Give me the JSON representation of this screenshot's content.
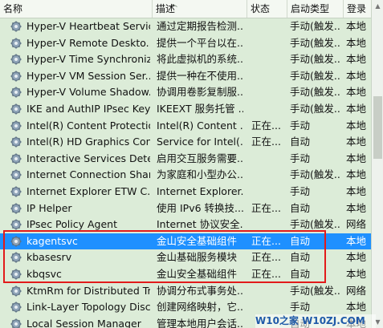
{
  "columns": {
    "name": "名称",
    "desc": "描述",
    "status": "状态",
    "startup": "启动类型",
    "logon": "登录"
  },
  "rows": [
    {
      "name": "Hyper-V Heartbeat Service",
      "desc": "通过定期报告检测...",
      "status": "",
      "startup": "手动(触发...",
      "logon": "本地"
    },
    {
      "name": "Hyper-V Remote Deskto...",
      "desc": "提供一个平台以在...",
      "status": "",
      "startup": "手动(触发...",
      "logon": "本地"
    },
    {
      "name": "Hyper-V Time Synchroniz...",
      "desc": "将此虚拟机的系统...",
      "status": "",
      "startup": "手动(触发...",
      "logon": "本地"
    },
    {
      "name": "Hyper-V VM Session Ser...",
      "desc": "提供一种在不使用...",
      "status": "",
      "startup": "手动(触发...",
      "logon": "本地"
    },
    {
      "name": "Hyper-V Volume Shadow...",
      "desc": "协调用卷影复制服...",
      "status": "",
      "startup": "手动(触发...",
      "logon": "本地"
    },
    {
      "name": "IKE and AuthIP IPsec Key...",
      "desc": "IKEEXT 服务托管 ...",
      "status": "",
      "startup": "手动(触发...",
      "logon": "本地"
    },
    {
      "name": "Intel(R) Content Protectio...",
      "desc": "Intel(R) Content ...",
      "status": "正在...",
      "startup": "手动",
      "logon": "本地"
    },
    {
      "name": "Intel(R) HD Graphics Con...",
      "desc": "Service for Intel(...",
      "status": "正在...",
      "startup": "自动",
      "logon": "本地"
    },
    {
      "name": "Interactive Services Dete...",
      "desc": "启用交互服务需要...",
      "status": "",
      "startup": "手动",
      "logon": "本地"
    },
    {
      "name": "Internet Connection Shari...",
      "desc": "为家庭和小型办公...",
      "status": "",
      "startup": "手动(触发...",
      "logon": "本地"
    },
    {
      "name": "Internet Explorer ETW C...",
      "desc": "Internet Explorer...",
      "status": "",
      "startup": "手动",
      "logon": "本地"
    },
    {
      "name": "IP Helper",
      "desc": "使用 IPv6 转换技...",
      "status": "正在...",
      "startup": "自动",
      "logon": "本地"
    },
    {
      "name": "IPsec Policy Agent",
      "desc": "Internet 协议安全...",
      "status": "",
      "startup": "手动(触发...",
      "logon": "网络"
    },
    {
      "name": "kagentsvc",
      "desc": "金山安全基础组件",
      "status": "正在...",
      "startup": "自动",
      "logon": "本地",
      "selected": true
    },
    {
      "name": "kbasesrv",
      "desc": "金山基础服务模块",
      "status": "正在...",
      "startup": "自动",
      "logon": "本地"
    },
    {
      "name": "kbqsvc",
      "desc": "金山安全基础组件",
      "status": "正在...",
      "startup": "自动",
      "logon": "本地"
    },
    {
      "name": "KtmRm for Distributed Tr...",
      "desc": "协调分布式事务处...",
      "status": "",
      "startup": "手动(触发...",
      "logon": "网络"
    },
    {
      "name": "Link-Layer Topology Disc...",
      "desc": "创建网络映射，它...",
      "status": "",
      "startup": "手动",
      "logon": "本地"
    },
    {
      "name": "Local Session Manager",
      "desc": "管理本地用户会话...",
      "status": "",
      "startup": "自动",
      "logon": "本地"
    }
  ],
  "watermark": "W10之家 W10ZJ.COM",
  "colors": {
    "background": "#dcecd8",
    "selected": "#1e90ff",
    "highlight_box": "#e21b1b"
  }
}
